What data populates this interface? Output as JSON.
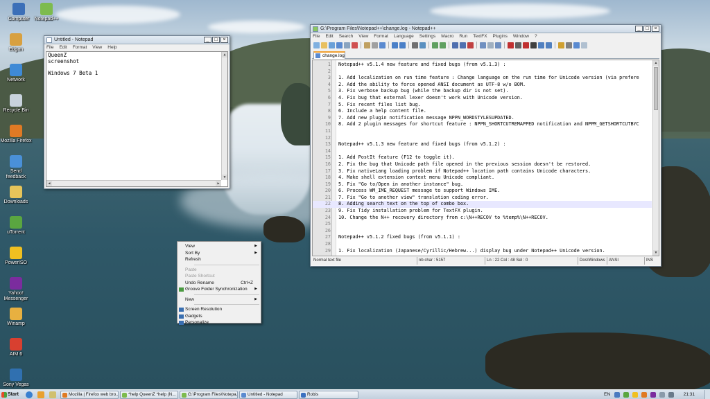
{
  "desktop_icons": [
    {
      "label": "Computer",
      "color": "#3b6fb8"
    },
    {
      "label": "Notepad++",
      "color": "#7dbb4e"
    },
    {
      "label": "Edgan",
      "color": "#d8a040"
    },
    {
      "label": "Network",
      "color": "#3f8ad6"
    },
    {
      "label": "Recycle Bin",
      "color": "#c9d3dd"
    },
    {
      "label": "Mozilla Firefox",
      "color": "#e07a24"
    },
    {
      "label": "Send feedback",
      "color": "#4a90d8"
    },
    {
      "label": "Downloads",
      "color": "#e6c45a"
    },
    {
      "label": "uTorrent",
      "color": "#5aa640"
    },
    {
      "label": "PowerISO",
      "color": "#f0c020"
    },
    {
      "label": "Yahoo! Messenger",
      "color": "#7b2c9e"
    },
    {
      "label": "Winamp",
      "color": "#e8b040"
    },
    {
      "label": "AIM 6",
      "color": "#d84030"
    },
    {
      "label": "Sony Vegas",
      "color": "#3070b0"
    }
  ],
  "notepad": {
    "title": "Untitled - Notepad",
    "menu": [
      "File",
      "Edit",
      "Format",
      "View",
      "Help"
    ],
    "content_lines": [
      "QueenZ",
      "screenshot",
      "",
      "Windows 7 Beta 1"
    ]
  },
  "npp": {
    "title": "G:\\Program Files\\Notepad++\\change.log - Notepad++",
    "menu": [
      "File",
      "Edit",
      "Search",
      "View",
      "Format",
      "Language",
      "Settings",
      "Macro",
      "Run",
      "TextFX",
      "Plugins",
      "Window",
      "?"
    ],
    "tab": "change.log",
    "current_line": 22,
    "lines": [
      {
        "n": "1",
        "t": "Notepad++ v5.1.4 new feature and fixed bugs (from v5.1.3) :"
      },
      {
        "n": "2",
        "t": ""
      },
      {
        "n": "3",
        "t": "1.  Add localization on run time feature : Change language on the run time for Unicode version (via prefere"
      },
      {
        "n": "4",
        "t": "2.  Add the ability to force opened ANSI document as UTF-8 w/o BOM."
      },
      {
        "n": "5",
        "t": "3.  Fix verbose backup bug (while the backup dir is not set)."
      },
      {
        "n": "6",
        "t": "4.  Fix bug that external lexer doesn't work with Unicode version."
      },
      {
        "n": "7",
        "t": "5.  Fix recent files list bug."
      },
      {
        "n": "8",
        "t": "6.  Include a help content file."
      },
      {
        "n": "9",
        "t": "7.  Add new plugin notification message NPPN_WORDSTYLESUPDATED."
      },
      {
        "n": "10",
        "t": "8.  Add 2 plugin messages for shortcut feature : NPPN_SHORTCUTREMAPPED notification and NPPM_GETSHORTCUTBYC"
      },
      {
        "n": "11",
        "t": ""
      },
      {
        "n": "12",
        "t": ""
      },
      {
        "n": "13",
        "t": "Notepad++ v5.1.3 new feature and fixed bugs (from v5.1.2) :"
      },
      {
        "n": "14",
        "t": ""
      },
      {
        "n": "15",
        "t": "1.  Add PostIt feature (F12 to toggle it)."
      },
      {
        "n": "16",
        "t": "2.  Fix the bug that Unicode path file opened in the previous session doesn't be restored."
      },
      {
        "n": "17",
        "t": "3.  Fix nativeLang loading problem if Notepad++ location path contains Unicode characters."
      },
      {
        "n": "18",
        "t": "4.  Make shell extension context menu Unicode compliant."
      },
      {
        "n": "19",
        "t": "5.  Fix \"Go to/Open in another instance\" bug."
      },
      {
        "n": "20",
        "t": "6.  Process WM_IME_REQUEST message to support Windows IME."
      },
      {
        "n": "21",
        "t": "7.  Fix \"Go to another view\" translation coding error."
      },
      {
        "n": "22",
        "t": "8.  Adding search text on the top of combo box."
      },
      {
        "n": "23",
        "t": "9.  Fix Tidy installation problem for TextFX plugin."
      },
      {
        "n": "24",
        "t": "10. Change the N++ recovery directory from c:\\N++RECOV to %temp%\\N++RECOV."
      },
      {
        "n": "25",
        "t": ""
      },
      {
        "n": "26",
        "t": ""
      },
      {
        "n": "27",
        "t": "Notepad++ v5.1.2 fixed bugs (from v5.1.1) :"
      },
      {
        "n": "28",
        "t": ""
      },
      {
        "n": "29",
        "t": "1.  Fix localization (Japanese/Cyrillic/Hebrew...) display bug under Notepad++ Unicode version."
      }
    ],
    "status": {
      "type": "Normal text file",
      "chars": "nb char : 5157",
      "pos": "Ln : 22    Col : 48    Sel : 0",
      "eol": "Dos\\Windows",
      "enc": "ANSI",
      "mode": "INS"
    }
  },
  "context_menu": {
    "items": [
      {
        "label": "View",
        "arrow": true
      },
      {
        "label": "Sort By",
        "arrow": true
      },
      {
        "label": "Refresh"
      },
      {
        "sep": true
      },
      {
        "label": "Paste",
        "disabled": true
      },
      {
        "label": "Paste Shortcut",
        "disabled": true
      },
      {
        "label": "Undo Rename",
        "shortcut": "Ctrl+Z"
      },
      {
        "label": "Groove Folder Synchronization",
        "arrow": true,
        "icon": "#4a9a40"
      },
      {
        "sep": true
      },
      {
        "label": "New",
        "arrow": true
      },
      {
        "sep": true
      },
      {
        "label": "Screen Resolution",
        "icon": "#3a6fb0"
      },
      {
        "label": "Gadgets",
        "icon": "#3a6fb0"
      },
      {
        "label": "Personalize",
        "icon": "#3a6fb0"
      }
    ]
  },
  "taskbar": {
    "start": "Start",
    "tasks": [
      {
        "label": "Mozilla | Firefox web bro...",
        "color": "#e07a24"
      },
      {
        "label": "*help QueenZ *help (N...",
        "color": "#7dbb4e"
      },
      {
        "label": "G:\\Program Files\\Notepa...",
        "color": "#7dbb4e"
      },
      {
        "label": "Untitled - Notepad",
        "color": "#5a8ad0"
      },
      {
        "label": "Robis",
        "color": "#3a70c0"
      }
    ],
    "language": "EN",
    "clock": "21:31"
  }
}
